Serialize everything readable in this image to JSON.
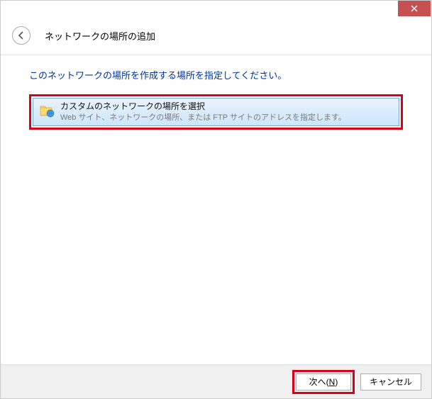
{
  "titlebar": {
    "close_icon": "close"
  },
  "header": {
    "title": "ネットワークの場所の追加"
  },
  "content": {
    "instruction": "このネットワークの場所を作成する場所を指定してください。",
    "option": {
      "title": "カスタムのネットワークの場所を選択",
      "desc": "Web サイト、ネットワークの場所、または FTP サイトのアドレスを指定します。"
    }
  },
  "footer": {
    "next_label_prefix": "次へ(",
    "next_mnemonic": "N",
    "next_label_suffix": ")",
    "cancel_label": "キャンセル"
  }
}
